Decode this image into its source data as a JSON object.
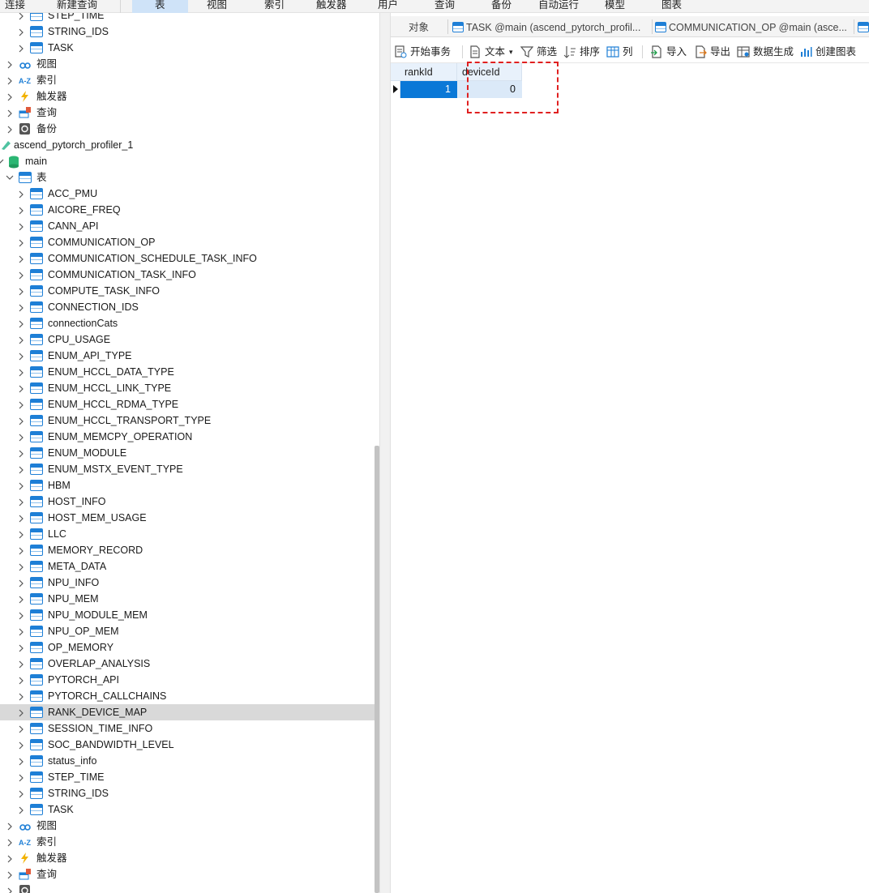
{
  "menu": {
    "items": [
      "连接",
      "新建查询",
      "表",
      "视图",
      "索引",
      "触发器",
      "用户",
      "查询",
      "备份",
      "自动运行",
      "模型",
      "图表"
    ],
    "active": "表"
  },
  "tree": {
    "top_items": [
      "STEP_TIME",
      "STRING_IDS",
      "TASK"
    ],
    "top_groups": [
      "视图",
      "索引",
      "触发器",
      "查询",
      "备份"
    ],
    "connection": "ascend_pytorch_profiler_1",
    "database": "main",
    "tables_group": "表",
    "tables": [
      "ACC_PMU",
      "AICORE_FREQ",
      "CANN_API",
      "COMMUNICATION_OP",
      "COMMUNICATION_SCHEDULE_TASK_INFO",
      "COMMUNICATION_TASK_INFO",
      "COMPUTE_TASK_INFO",
      "CONNECTION_IDS",
      "connectionCats",
      "CPU_USAGE",
      "ENUM_API_TYPE",
      "ENUM_HCCL_DATA_TYPE",
      "ENUM_HCCL_LINK_TYPE",
      "ENUM_HCCL_RDMA_TYPE",
      "ENUM_HCCL_TRANSPORT_TYPE",
      "ENUM_MEMCPY_OPERATION",
      "ENUM_MODULE",
      "ENUM_MSTX_EVENT_TYPE",
      "HBM",
      "HOST_INFO",
      "HOST_MEM_USAGE",
      "LLC",
      "MEMORY_RECORD",
      "META_DATA",
      "NPU_INFO",
      "NPU_MEM",
      "NPU_MODULE_MEM",
      "NPU_OP_MEM",
      "OP_MEMORY",
      "OVERLAP_ANALYSIS",
      "PYTORCH_API",
      "PYTORCH_CALLCHAINS",
      "RANK_DEVICE_MAP",
      "SESSION_TIME_INFO",
      "SOC_BANDWIDTH_LEVEL",
      "status_info",
      "STEP_TIME",
      "STRING_IDS",
      "TASK"
    ],
    "selected_table": "RANK_DEVICE_MAP",
    "bottom_groups": [
      "视图",
      "索引",
      "触发器",
      "查询"
    ]
  },
  "tabs": [
    {
      "label": "对象",
      "icon": "none"
    },
    {
      "label": "TASK @main (ascend_pytorch_profil...",
      "icon": "table-icon"
    },
    {
      "label": "COMMUNICATION_OP @main (asce...",
      "icon": "table-icon"
    }
  ],
  "toolbar": {
    "begin_transaction": "开始事务",
    "text": "文本",
    "filter": "筛选",
    "sort": "排序",
    "columns": "列",
    "import": "导入",
    "export": "导出",
    "data_generation": "数据生成",
    "create_chart": "创建图表"
  },
  "grid": {
    "columns": [
      "rankId",
      "deviceId"
    ],
    "rows": [
      [
        "1",
        "0"
      ]
    ]
  },
  "colors": {
    "accent": "#1e7fd6",
    "selection": "#0a78d7",
    "annotation": "#e02020"
  }
}
